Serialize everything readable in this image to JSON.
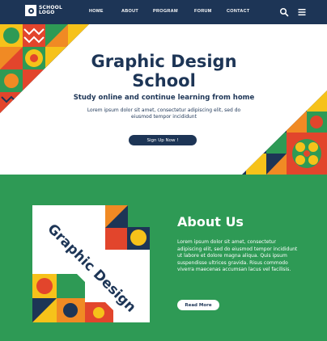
{
  "nav": {
    "logo_text": "SCHOOL\nLOGO",
    "items": [
      {
        "label": "HOME"
      },
      {
        "label": "ABOUT"
      },
      {
        "label": "PROGRAM"
      },
      {
        "label": "FORUM"
      },
      {
        "label": "CONTACT"
      }
    ],
    "icons": [
      "search-icon",
      "hamburger-menu-icon"
    ]
  },
  "hero": {
    "title": "Graphic Design School",
    "subtitle": "Study online and continue learning from home",
    "body": "Lorem ipsum dolor sit amet, consectetur adipiscing elit, sed do eiusmod tempor incididunt",
    "cta_label": "Sign Up Now !"
  },
  "about": {
    "title": "About Us",
    "card_text": "Graphic Design",
    "body": "Lorem ipsum dolor sit amet, consectetur adipiscing elit, sed do eiusmod tempor incididunt ut labore et dolore magna aliqua. Quis ipsum suspendisse ultrices gravida. Risus commodo viverra maecenas accumsan lacus vel facilisis.",
    "cta_label": "Read More"
  },
  "colors": {
    "navy": "#1d3556",
    "green": "#2e9a55",
    "orange": "#f08a24",
    "red": "#e2452c",
    "yellow": "#f6c21a",
    "white": "#ffffff"
  }
}
